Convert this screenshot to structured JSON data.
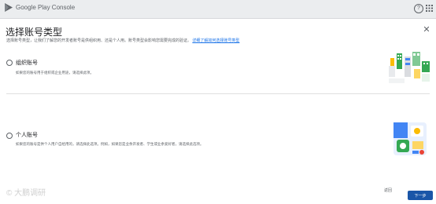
{
  "app": {
    "name": "Google Play Console",
    "help_icon": "help-icon"
  },
  "dialog": {
    "title": "选择账号类型",
    "close_symbol": "✕",
    "subtitle": "选择账号类型，让我们了解您的开发者账号是供组织用、还是个人用。账号类型会影响您需要完成的验证。",
    "subtitle_link": "详细了解如何选择账号类型",
    "options": [
      {
        "title": "组织账号",
        "description": "如果您的账号用于组织或企业用途，请选择此项。",
        "illustration": "organization-illustration"
      },
      {
        "title": "个人账号",
        "description": "如果您的账号是供个人用户自给用的，请选择此选项。例如，如果您是业余开发者、学生或业余爱好者，请选择此选项。",
        "illustration": "personal-illustration"
      }
    ]
  },
  "footer": {
    "watermark": "© 大鹏调研",
    "back_label": "返回",
    "next_label": "下一步"
  },
  "colors": {
    "accent": "#1a73e8",
    "primary_button": "#1a56a8",
    "topbar": "#ebedef"
  }
}
